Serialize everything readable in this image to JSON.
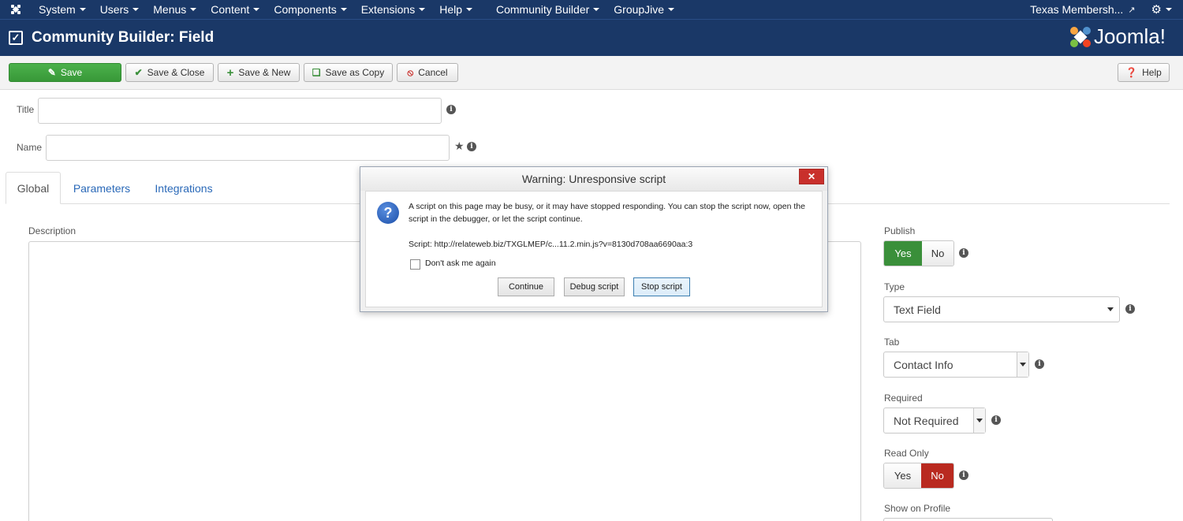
{
  "topnav": {
    "menu": [
      {
        "label": "System"
      },
      {
        "label": "Users"
      },
      {
        "label": "Menus"
      },
      {
        "label": "Content"
      },
      {
        "label": "Components"
      },
      {
        "label": "Extensions"
      },
      {
        "label": "Help"
      },
      {
        "label": "Community Builder"
      },
      {
        "label": "GroupJive"
      }
    ],
    "user": "Texas Membersh..."
  },
  "header": {
    "title": "Community Builder: Field",
    "logo_text": "Joomla!"
  },
  "toolbar": {
    "save": "Save",
    "save_close": "Save & Close",
    "save_new": "Save & New",
    "save_copy": "Save as Copy",
    "cancel": "Cancel",
    "help": "Help"
  },
  "form": {
    "title_label": "Title",
    "title_value": "",
    "name_label": "Name",
    "name_value": ""
  },
  "tabs": [
    {
      "label": "Global"
    },
    {
      "label": "Parameters"
    },
    {
      "label": "Integrations"
    }
  ],
  "description_label": "Description",
  "right": {
    "publish_label": "Publish",
    "publish_yes": "Yes",
    "publish_no": "No",
    "type_label": "Type",
    "type_value": "Text Field",
    "tab_label": "Tab",
    "tab_value": "Contact Info",
    "required_label": "Required",
    "required_value": "Not Required",
    "readonly_label": "Read Only",
    "readonly_yes": "Yes",
    "readonly_no": "No",
    "show_profile_label": "Show on Profile"
  },
  "dialog": {
    "title": "Warning: Unresponsive script",
    "message": "A script on this page may be busy, or it may have stopped responding. You can stop the script now, open the script in the debugger, or let the script continue.",
    "script": "Script: http://relateweb.biz/TXGLMEP/c...11.2.min.js?v=8130d708aa6690aa:3",
    "dont_ask": "Don't ask me again",
    "continue": "Continue",
    "debug": "Debug script",
    "stop": "Stop script"
  },
  "colors": {
    "navbar": "#1a3867",
    "save_green": "#3f9f3f",
    "publish_yes_green": "#3a8f3a",
    "readonly_no_red": "#b92a20",
    "link_blue": "#2a69b8"
  }
}
